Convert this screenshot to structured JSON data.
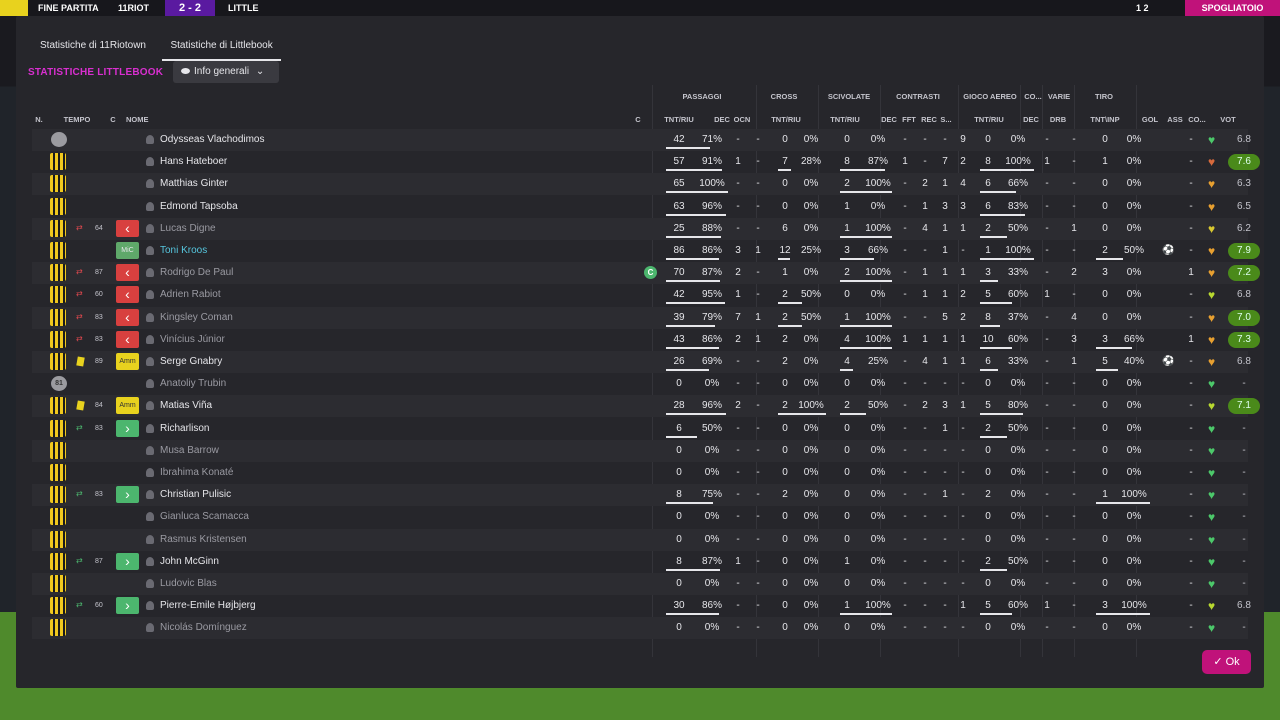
{
  "topbar": {
    "left": "FINE PARTITA",
    "team1": "11RIOT",
    "score": "2 - 2",
    "team2": "LITTLE",
    "right_score": "1 2",
    "right_btn": "SPOGLIATOIO"
  },
  "tabs": [
    "Statistiche di 11Riotown",
    "Statistiche di Littlebook"
  ],
  "section_title": "STATISTICHE LITTLEBOOK",
  "dropdown": "Info generali",
  "groups": [
    "PASSAGGI",
    "CROSS",
    "SCIVOLATE",
    "CONTRASTI",
    "GIOCO AEREO",
    "CO...",
    "VARIE",
    "TIRO"
  ],
  "headers": [
    "N.",
    "TEMPO",
    "C",
    "NOME",
    "C",
    "TNT/RIU",
    "DEC",
    "OCN",
    "TNT/RIU",
    "TNT/RIU",
    "DEC",
    "FFT",
    "REC",
    "S...",
    "TNT/RIU",
    "DEC",
    "DRB",
    "TNT\\INP",
    "GOL",
    "ASS",
    "CO...",
    "VOT"
  ],
  "ok_label": "Ok",
  "colors": {
    "accent": "#d92fd0",
    "ok": "#c0127a",
    "vote_good": "#4a8a1a"
  },
  "players": [
    {
      "name": "Odysseas Vlachodimos",
      "gk": true,
      "tempo": "",
      "c": "",
      "pass": [
        "42",
        "71%"
      ],
      "dec": "-",
      "ocn": "-",
      "cross": [
        "0",
        "0%"
      ],
      "sciv": [
        "0",
        "0%"
      ],
      "contr": [
        "-",
        "-",
        "-",
        "9"
      ],
      "aereo": [
        "0",
        "0%"
      ],
      "co": "-",
      "drb": "-",
      "tiro": [
        "0",
        "0%"
      ],
      "gol": "",
      "ass": "-",
      "heart": "#4cc86a",
      "vote": "6.8",
      "vg": false,
      "dim": false
    },
    {
      "name": "Hans Hateboer",
      "gk": false,
      "tempo": "",
      "c": "",
      "pass": [
        "57",
        "91%"
      ],
      "dec": "1",
      "ocn": "-",
      "cross": [
        "7",
        "28%"
      ],
      "sciv": [
        "8",
        "87%"
      ],
      "contr": [
        "1",
        "-",
        "7",
        "2"
      ],
      "aereo": [
        "8",
        "100%"
      ],
      "co": "1",
      "drb": "-",
      "tiro": [
        "1",
        "0%"
      ],
      "gol": "",
      "ass": "-",
      "heart": "#d86a3c",
      "vote": "7.6",
      "vg": true,
      "dim": false
    },
    {
      "name": "Matthias Ginter",
      "gk": false,
      "tempo": "",
      "c": "",
      "pass": [
        "65",
        "100%"
      ],
      "dec": "-",
      "ocn": "-",
      "cross": [
        "0",
        "0%"
      ],
      "sciv": [
        "2",
        "100%"
      ],
      "contr": [
        "-",
        "2",
        "1",
        "4"
      ],
      "aereo": [
        "6",
        "66%"
      ],
      "co": "-",
      "drb": "-",
      "tiro": [
        "0",
        "0%"
      ],
      "gol": "",
      "ass": "-",
      "heart": "#e8a030",
      "vote": "6.3",
      "vg": false,
      "dim": false
    },
    {
      "name": "Edmond Tapsoba",
      "gk": false,
      "tempo": "",
      "c": "",
      "pass": [
        "63",
        "96%"
      ],
      "dec": "-",
      "ocn": "-",
      "cross": [
        "0",
        "0%"
      ],
      "sciv": [
        "1",
        "0%"
      ],
      "contr": [
        "-",
        "1",
        "3",
        "3"
      ],
      "aereo": [
        "6",
        "83%"
      ],
      "co": "-",
      "drb": "-",
      "tiro": [
        "0",
        "0%"
      ],
      "gol": "",
      "ass": "-",
      "heart": "#e8a030",
      "vote": "6.5",
      "vg": false,
      "dim": false
    },
    {
      "name": "Lucas Digne",
      "gk": false,
      "tempo": "64",
      "sub": "red",
      "badge": "red",
      "c": "",
      "pass": [
        "25",
        "88%"
      ],
      "dec": "-",
      "ocn": "-",
      "cross": [
        "6",
        "0%"
      ],
      "sciv": [
        "1",
        "100%"
      ],
      "contr": [
        "-",
        "4",
        "1",
        "1"
      ],
      "aereo": [
        "2",
        "50%"
      ],
      "co": "-",
      "drb": "1",
      "tiro": [
        "0",
        "0%"
      ],
      "gol": "",
      "ass": "-",
      "heart": "#d8c830",
      "vote": "6.2",
      "vg": false,
      "dim": true
    },
    {
      "name": "Toni Kroos",
      "gk": false,
      "tempo": "",
      "badge": "mc",
      "badgetext": "MiC",
      "c": "",
      "pass": [
        "86",
        "86%"
      ],
      "dec": "3",
      "ocn": "1",
      "cross": [
        "12",
        "25%"
      ],
      "sciv": [
        "3",
        "66%"
      ],
      "contr": [
        "-",
        "-",
        "1",
        "-"
      ],
      "aereo": [
        "1",
        "100%"
      ],
      "co": "-",
      "drb": "-",
      "tiro": [
        "2",
        "50%"
      ],
      "gol": "⚽",
      "ass": "-",
      "heart": "#e8a030",
      "vote": "7.9",
      "vg": true,
      "dim": false,
      "hl": true
    },
    {
      "name": "Rodrigo De Paul",
      "gk": false,
      "tempo": "87",
      "sub": "red",
      "badge": "red",
      "c": "C",
      "pass": [
        "70",
        "87%"
      ],
      "dec": "2",
      "ocn": "-",
      "cross": [
        "1",
        "0%"
      ],
      "sciv": [
        "2",
        "100%"
      ],
      "contr": [
        "-",
        "1",
        "1",
        "1"
      ],
      "aereo": [
        "3",
        "33%"
      ],
      "co": "-",
      "drb": "2",
      "tiro": [
        "3",
        "0%"
      ],
      "gol": "",
      "ass": "1",
      "heart": "#e8a030",
      "vote": "7.2",
      "vg": true,
      "dim": true
    },
    {
      "name": "Adrien Rabiot",
      "gk": false,
      "tempo": "60",
      "sub": "red",
      "badge": "red",
      "c": "",
      "pass": [
        "42",
        "95%"
      ],
      "dec": "1",
      "ocn": "-",
      "cross": [
        "2",
        "50%"
      ],
      "sciv": [
        "0",
        "0%"
      ],
      "contr": [
        "-",
        "1",
        "1",
        "2"
      ],
      "aereo": [
        "5",
        "60%"
      ],
      "co": "1",
      "drb": "-",
      "tiro": [
        "0",
        "0%"
      ],
      "gol": "",
      "ass": "-",
      "heart": "#b8d830",
      "vote": "6.8",
      "vg": false,
      "dim": true
    },
    {
      "name": "Kingsley Coman",
      "gk": false,
      "tempo": "83",
      "sub": "red",
      "badge": "red",
      "c": "",
      "pass": [
        "39",
        "79%"
      ],
      "dec": "7",
      "ocn": "1",
      "cross": [
        "2",
        "50%"
      ],
      "sciv": [
        "1",
        "100%"
      ],
      "contr": [
        "-",
        "-",
        "5",
        "2"
      ],
      "aereo": [
        "8",
        "37%"
      ],
      "co": "-",
      "drb": "4",
      "tiro": [
        "0",
        "0%"
      ],
      "gol": "",
      "ass": "-",
      "heart": "#e8a030",
      "vote": "7.0",
      "vg": true,
      "dim": true
    },
    {
      "name": "Vinícius Júnior",
      "gk": false,
      "tempo": "83",
      "sub": "red",
      "badge": "red",
      "c": "",
      "pass": [
        "43",
        "86%"
      ],
      "dec": "2",
      "ocn": "1",
      "cross": [
        "2",
        "0%"
      ],
      "sciv": [
        "4",
        "100%"
      ],
      "contr": [
        "1",
        "1",
        "1",
        "1"
      ],
      "aereo": [
        "10",
        "60%"
      ],
      "co": "-",
      "drb": "3",
      "tiro": [
        "3",
        "66%"
      ],
      "gol": "",
      "ass": "1",
      "heart": "#e8a030",
      "vote": "7.3",
      "vg": true,
      "dim": true
    },
    {
      "name": "Serge Gnabry",
      "gk": false,
      "tempo": "89",
      "yc": true,
      "badge": "yel",
      "badgetext": "Amm",
      "c": "",
      "pass": [
        "26",
        "69%"
      ],
      "dec": "-",
      "ocn": "-",
      "cross": [
        "2",
        "0%"
      ],
      "sciv": [
        "4",
        "25%"
      ],
      "contr": [
        "-",
        "4",
        "1",
        "1"
      ],
      "aereo": [
        "6",
        "33%"
      ],
      "co": "-",
      "drb": "1",
      "tiro": [
        "5",
        "40%"
      ],
      "gol": "⚽",
      "ass": "-",
      "heart": "#e8a030",
      "vote": "6.8",
      "vg": false,
      "dim": false
    },
    {
      "name": "Anatoliy Trubin",
      "gk": true,
      "gknum": "81",
      "tempo": "",
      "c": "",
      "pass": [
        "0",
        "0%"
      ],
      "dec": "-",
      "ocn": "-",
      "cross": [
        "0",
        "0%"
      ],
      "sciv": [
        "0",
        "0%"
      ],
      "contr": [
        "-",
        "-",
        "-",
        "-"
      ],
      "aereo": [
        "0",
        "0%"
      ],
      "co": "-",
      "drb": "-",
      "tiro": [
        "0",
        "0%"
      ],
      "gol": "",
      "ass": "-",
      "heart": "#4cc86a",
      "vote": "-",
      "vg": false,
      "dim": true
    },
    {
      "name": "Matias Viña",
      "gk": false,
      "tempo": "84",
      "yc": true,
      "badge": "yel",
      "badgetext": "Amm",
      "c": "",
      "pass": [
        "28",
        "96%"
      ],
      "dec": "2",
      "ocn": "-",
      "cross": [
        "2",
        "100%"
      ],
      "sciv": [
        "2",
        "50%"
      ],
      "contr": [
        "-",
        "2",
        "3",
        "1"
      ],
      "aereo": [
        "5",
        "80%"
      ],
      "co": "-",
      "drb": "-",
      "tiro": [
        "0",
        "0%"
      ],
      "gol": "",
      "ass": "-",
      "heart": "#b8d830",
      "vote": "7.1",
      "vg": true,
      "dim": false
    },
    {
      "name": "Richarlison",
      "gk": false,
      "tempo": "83",
      "sub": "green",
      "badge": "green",
      "c": "",
      "pass": [
        "6",
        "50%"
      ],
      "dec": "-",
      "ocn": "-",
      "cross": [
        "0",
        "0%"
      ],
      "sciv": [
        "0",
        "0%"
      ],
      "contr": [
        "-",
        "-",
        "1",
        "-"
      ],
      "aereo": [
        "2",
        "50%"
      ],
      "co": "-",
      "drb": "-",
      "tiro": [
        "0",
        "0%"
      ],
      "gol": "",
      "ass": "-",
      "heart": "#4cc86a",
      "vote": "-",
      "vg": false,
      "dim": false
    },
    {
      "name": "Musa Barrow",
      "gk": false,
      "tempo": "",
      "c": "",
      "pass": [
        "0",
        "0%"
      ],
      "dec": "-",
      "ocn": "-",
      "cross": [
        "0",
        "0%"
      ],
      "sciv": [
        "0",
        "0%"
      ],
      "contr": [
        "-",
        "-",
        "-",
        "-"
      ],
      "aereo": [
        "0",
        "0%"
      ],
      "co": "-",
      "drb": "-",
      "tiro": [
        "0",
        "0%"
      ],
      "gol": "",
      "ass": "-",
      "heart": "#4cc86a",
      "vote": "-",
      "vg": false,
      "dim": true
    },
    {
      "name": "Ibrahima Konaté",
      "gk": false,
      "tempo": "",
      "c": "",
      "pass": [
        "0",
        "0%"
      ],
      "dec": "-",
      "ocn": "-",
      "cross": [
        "0",
        "0%"
      ],
      "sciv": [
        "0",
        "0%"
      ],
      "contr": [
        "-",
        "-",
        "-",
        "-"
      ],
      "aereo": [
        "0",
        "0%"
      ],
      "co": "-",
      "drb": "-",
      "tiro": [
        "0",
        "0%"
      ],
      "gol": "",
      "ass": "-",
      "heart": "#4cc86a",
      "vote": "-",
      "vg": false,
      "dim": true
    },
    {
      "name": "Christian Pulisic",
      "gk": false,
      "tempo": "83",
      "sub": "green",
      "badge": "green",
      "c": "",
      "pass": [
        "8",
        "75%"
      ],
      "dec": "-",
      "ocn": "-",
      "cross": [
        "2",
        "0%"
      ],
      "sciv": [
        "0",
        "0%"
      ],
      "contr": [
        "-",
        "-",
        "1",
        "-"
      ],
      "aereo": [
        "2",
        "0%"
      ],
      "co": "-",
      "drb": "-",
      "tiro": [
        "1",
        "100%"
      ],
      "gol": "",
      "ass": "-",
      "heart": "#4cc86a",
      "vote": "-",
      "vg": false,
      "dim": false
    },
    {
      "name": "Gianluca Scamacca",
      "gk": false,
      "tempo": "",
      "c": "",
      "pass": [
        "0",
        "0%"
      ],
      "dec": "-",
      "ocn": "-",
      "cross": [
        "0",
        "0%"
      ],
      "sciv": [
        "0",
        "0%"
      ],
      "contr": [
        "-",
        "-",
        "-",
        "-"
      ],
      "aereo": [
        "0",
        "0%"
      ],
      "co": "-",
      "drb": "-",
      "tiro": [
        "0",
        "0%"
      ],
      "gol": "",
      "ass": "-",
      "heart": "#4cc86a",
      "vote": "-",
      "vg": false,
      "dim": true
    },
    {
      "name": "Rasmus Kristensen",
      "gk": false,
      "tempo": "",
      "c": "",
      "pass": [
        "0",
        "0%"
      ],
      "dec": "-",
      "ocn": "-",
      "cross": [
        "0",
        "0%"
      ],
      "sciv": [
        "0",
        "0%"
      ],
      "contr": [
        "-",
        "-",
        "-",
        "-"
      ],
      "aereo": [
        "0",
        "0%"
      ],
      "co": "-",
      "drb": "-",
      "tiro": [
        "0",
        "0%"
      ],
      "gol": "",
      "ass": "-",
      "heart": "#4cc86a",
      "vote": "-",
      "vg": false,
      "dim": true
    },
    {
      "name": "John McGinn",
      "gk": false,
      "tempo": "87",
      "sub": "green",
      "badge": "green",
      "c": "",
      "pass": [
        "8",
        "87%"
      ],
      "dec": "1",
      "ocn": "-",
      "cross": [
        "0",
        "0%"
      ],
      "sciv": [
        "1",
        "0%"
      ],
      "contr": [
        "-",
        "-",
        "-",
        "-"
      ],
      "aereo": [
        "2",
        "50%"
      ],
      "co": "-",
      "drb": "-",
      "tiro": [
        "0",
        "0%"
      ],
      "gol": "",
      "ass": "-",
      "heart": "#4cc86a",
      "vote": "-",
      "vg": false,
      "dim": false
    },
    {
      "name": "Ludovic Blas",
      "gk": false,
      "tempo": "",
      "c": "",
      "pass": [
        "0",
        "0%"
      ],
      "dec": "-",
      "ocn": "-",
      "cross": [
        "0",
        "0%"
      ],
      "sciv": [
        "0",
        "0%"
      ],
      "contr": [
        "-",
        "-",
        "-",
        "-"
      ],
      "aereo": [
        "0",
        "0%"
      ],
      "co": "-",
      "drb": "-",
      "tiro": [
        "0",
        "0%"
      ],
      "gol": "",
      "ass": "-",
      "heart": "#4cc86a",
      "vote": "-",
      "vg": false,
      "dim": true
    },
    {
      "name": "Pierre-Emile Højbjerg",
      "gk": false,
      "tempo": "60",
      "sub": "green",
      "badge": "green",
      "c": "",
      "pass": [
        "30",
        "86%"
      ],
      "dec": "-",
      "ocn": "-",
      "cross": [
        "0",
        "0%"
      ],
      "sciv": [
        "1",
        "100%"
      ],
      "contr": [
        "-",
        "-",
        "-",
        "1"
      ],
      "aereo": [
        "5",
        "60%"
      ],
      "co": "1",
      "drb": "-",
      "tiro": [
        "3",
        "100%"
      ],
      "gol": "",
      "ass": "-",
      "heart": "#b8d830",
      "vote": "6.8",
      "vg": false,
      "dim": false
    },
    {
      "name": "Nicolás Domínguez",
      "gk": false,
      "tempo": "",
      "c": "",
      "pass": [
        "0",
        "0%"
      ],
      "dec": "-",
      "ocn": "-",
      "cross": [
        "0",
        "0%"
      ],
      "sciv": [
        "0",
        "0%"
      ],
      "contr": [
        "-",
        "-",
        "-",
        "-"
      ],
      "aereo": [
        "0",
        "0%"
      ],
      "co": "-",
      "drb": "-",
      "tiro": [
        "0",
        "0%"
      ],
      "gol": "",
      "ass": "-",
      "heart": "#4cc86a",
      "vote": "-",
      "vg": false,
      "dim": true
    }
  ]
}
